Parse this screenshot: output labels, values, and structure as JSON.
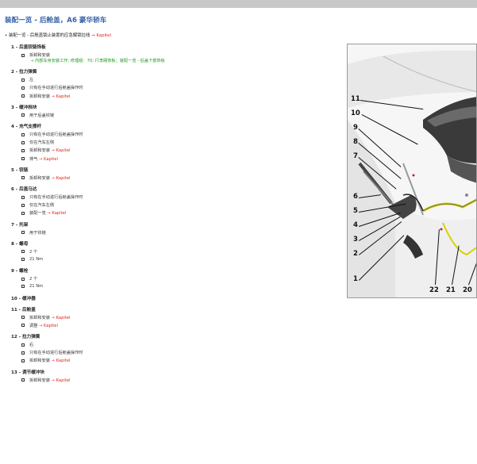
{
  "title": "装配一览 - 后舱盖，A6 豪华轿车",
  "intro": {
    "text": "装配一览 - 后舱盖锁止装置的应急解锁拉线 ",
    "link": "→ Kapitel"
  },
  "items": [
    {
      "num": "1 - ",
      "name": "后盖铰链饰板",
      "subs": [
        {
          "text": "拆卸和安装",
          "link": ""
        }
      ],
      "extra": "→ 内部车身安装工作; 修理组：70; 行李厢饰板；装配一览 - 后盖下部饰板"
    },
    {
      "num": "2 - ",
      "name": "拉力弹簧",
      "subs": [
        {
          "text": "左",
          "link": ""
        },
        {
          "text": "只有在手动进行后舱盖操作时",
          "link": ""
        },
        {
          "text": "拆卸和安装 ",
          "link": "→ Kapitel"
        }
      ]
    },
    {
      "num": "3 - ",
      "name": "缓冲挡块",
      "subs": [
        {
          "text": "用于后盖铰链",
          "link": ""
        }
      ]
    },
    {
      "num": "4 - ",
      "name": "充气支撑杆",
      "subs": [
        {
          "text": "只有在手动进行后舱盖操作时",
          "link": ""
        },
        {
          "text": "仅在汽车左侧",
          "link": ""
        },
        {
          "text": "拆卸和安装 ",
          "link": "→ Kapitel"
        },
        {
          "text": "排气 ",
          "link": "→ Kapitel"
        }
      ]
    },
    {
      "num": "5 - ",
      "name": "铰链",
      "subs": [
        {
          "text": "拆卸和安装 ",
          "link": "→ Kapitel"
        }
      ]
    },
    {
      "num": "6 - ",
      "name": "后盖马达",
      "subs": [
        {
          "text": "只有在手动进行后舱盖操作时",
          "link": ""
        },
        {
          "text": "仅在汽车左侧",
          "link": ""
        },
        {
          "text": "装配一览 ",
          "link": "→ Kapitel"
        }
      ]
    },
    {
      "num": "7 - ",
      "name": "托架",
      "subs": [
        {
          "text": "用于铰链",
          "link": ""
        }
      ]
    },
    {
      "num": "8 - ",
      "name": "螺母",
      "subs": [
        {
          "text": "2 个",
          "link": ""
        },
        {
          "text": "21 Nm",
          "link": ""
        }
      ]
    },
    {
      "num": "9 - ",
      "name": "螺栓",
      "subs": [
        {
          "text": "2 个",
          "link": ""
        },
        {
          "text": "21 Nm",
          "link": ""
        }
      ]
    },
    {
      "num": "10 - ",
      "name": "缓冲器",
      "subs": []
    },
    {
      "num": "11 - ",
      "name": "后舱盖",
      "subs": [
        {
          "text": "拆卸和安装 ",
          "link": "→ Kapitel"
        },
        {
          "text": "调整 ",
          "link": "→ Kapitel"
        }
      ]
    },
    {
      "num": "12 - ",
      "name": "拉力弹簧",
      "subs": [
        {
          "text": "右",
          "link": ""
        },
        {
          "text": "只有在手动进行后舱盖操作时",
          "link": ""
        },
        {
          "text": "拆卸和安装 ",
          "link": "→ Kapitel"
        }
      ]
    },
    {
      "num": "13 - ",
      "name": "调节缓冲块",
      "subs": [
        {
          "text": "拆卸和安装 ",
          "link": "→ Kapitel"
        }
      ]
    }
  ],
  "figure": {
    "left_labels": [
      "11",
      "10",
      "9",
      "8",
      "7",
      "6",
      "5",
      "4",
      "3",
      "2",
      "1"
    ],
    "bottom_labels": [
      "22",
      "21",
      "20"
    ]
  },
  "colors": {
    "title": "#3a63a8",
    "link": "#e0251b",
    "path": "#1e9a1e",
    "bar": "#c8c8c8"
  }
}
